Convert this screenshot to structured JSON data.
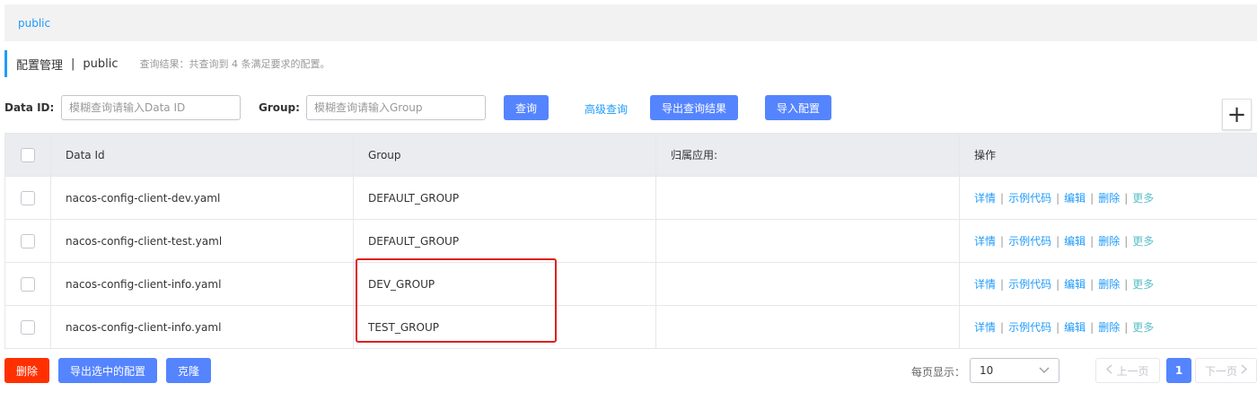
{
  "namespace_bar": {
    "active_tab": "public"
  },
  "page_header": {
    "title": "配置管理",
    "separator": "|",
    "namespace": "public",
    "result_hint": "查询结果：共查询到 4 条满足要求的配置。"
  },
  "search": {
    "data_id_label": "Data ID:",
    "data_id_placeholder": "模糊查询请输入Data ID",
    "group_label": "Group:",
    "group_placeholder": "模糊查询请输入Group",
    "query_button": "查询",
    "advanced_link": "高级查询",
    "export_results_button": "导出查询结果",
    "import_button": "导入配置",
    "add_icon": "+"
  },
  "table": {
    "headers": {
      "data_id": "Data Id",
      "group": "Group",
      "app": "归属应用:",
      "ops": "操作"
    },
    "ops_labels": {
      "detail": "详情",
      "sample": "示例代码",
      "edit": "编辑",
      "delete": "删除",
      "more": "更多",
      "sep": "|"
    },
    "rows": [
      {
        "data_id": "nacos-config-client-dev.yaml",
        "group": "DEFAULT_GROUP",
        "app": ""
      },
      {
        "data_id": "nacos-config-client-test.yaml",
        "group": "DEFAULT_GROUP",
        "app": ""
      },
      {
        "data_id": "nacos-config-client-info.yaml",
        "group": "DEV_GROUP",
        "app": ""
      },
      {
        "data_id": "nacos-config-client-info.yaml",
        "group": "TEST_GROUP",
        "app": ""
      }
    ]
  },
  "footer": {
    "delete_button": "删除",
    "export_selected_button": "导出选中的配置",
    "clone_button": "克隆",
    "page_size_label": "每页显示：",
    "page_size_value": "10",
    "prev_button": "上一页",
    "current_page": "1",
    "next_button": "下一页"
  },
  "colors": {
    "primary": "#5584ff",
    "link": "#209bfa",
    "danger": "#ff3000",
    "highlight_box": "#e02020"
  }
}
